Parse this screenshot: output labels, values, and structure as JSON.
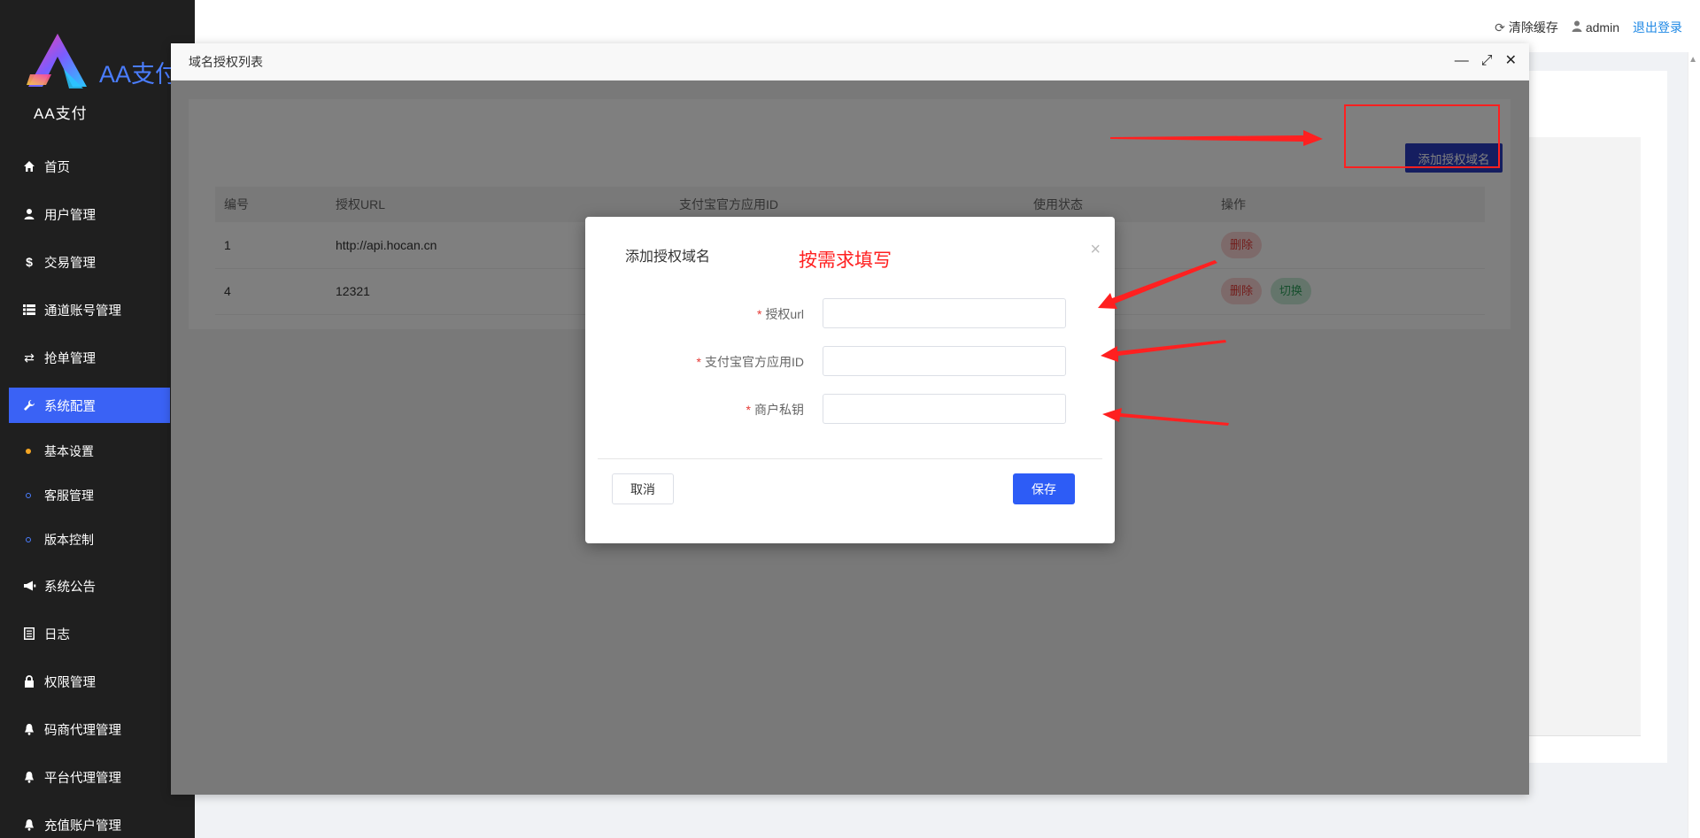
{
  "brand": {
    "logo_text": "AA支付",
    "logo_sub": "AA支付",
    "accent_color": "#3a62f5"
  },
  "sidebar": {
    "items": [
      {
        "label": "首页",
        "icon": "home-icon"
      },
      {
        "label": "用户管理",
        "icon": "user-icon"
      },
      {
        "label": "交易管理",
        "icon": "dollar-icon"
      },
      {
        "label": "通道账号管理",
        "icon": "list-icon"
      },
      {
        "label": "抢单管理",
        "icon": "exchange-icon"
      },
      {
        "label": "系统配置",
        "icon": "wrench-icon",
        "active": true
      },
      {
        "label": "系统公告",
        "icon": "megaphone-icon"
      },
      {
        "label": "日志",
        "icon": "log-icon"
      },
      {
        "label": "权限管理",
        "icon": "lock-icon"
      },
      {
        "label": "码商代理管理",
        "icon": "bell-icon"
      },
      {
        "label": "平台代理管理",
        "icon": "bell-icon"
      },
      {
        "label": "充值账户管理",
        "icon": "bell-icon"
      }
    ],
    "sub_items": [
      {
        "label": "基本设置"
      },
      {
        "label": "客服管理"
      },
      {
        "label": "版本控制"
      }
    ]
  },
  "topbar": {
    "clear_cache": "清除缓存",
    "username": "admin",
    "logout": "退出登录"
  },
  "layer": {
    "title": "域名授权列表"
  },
  "list": {
    "add_button": "添加授权域名",
    "columns": [
      "编号",
      "授权URL",
      "支付宝官方应用ID",
      "使用状态",
      "操作"
    ],
    "rows": [
      {
        "id": "1",
        "url": "http://api.hocan.cn",
        "delete": "删除"
      },
      {
        "id": "4",
        "url": "12321",
        "delete": "删除",
        "switch": "切换"
      }
    ]
  },
  "modal": {
    "title": "添加授权域名",
    "fields": [
      {
        "label": "授权url",
        "value": ""
      },
      {
        "label": "支付宝官方应用ID",
        "value": ""
      },
      {
        "label": "商户私钥",
        "value": ""
      }
    ],
    "cancel": "取消",
    "save": "保存"
  },
  "annotation": {
    "note": "按需求填写",
    "color": "#ff2020"
  }
}
